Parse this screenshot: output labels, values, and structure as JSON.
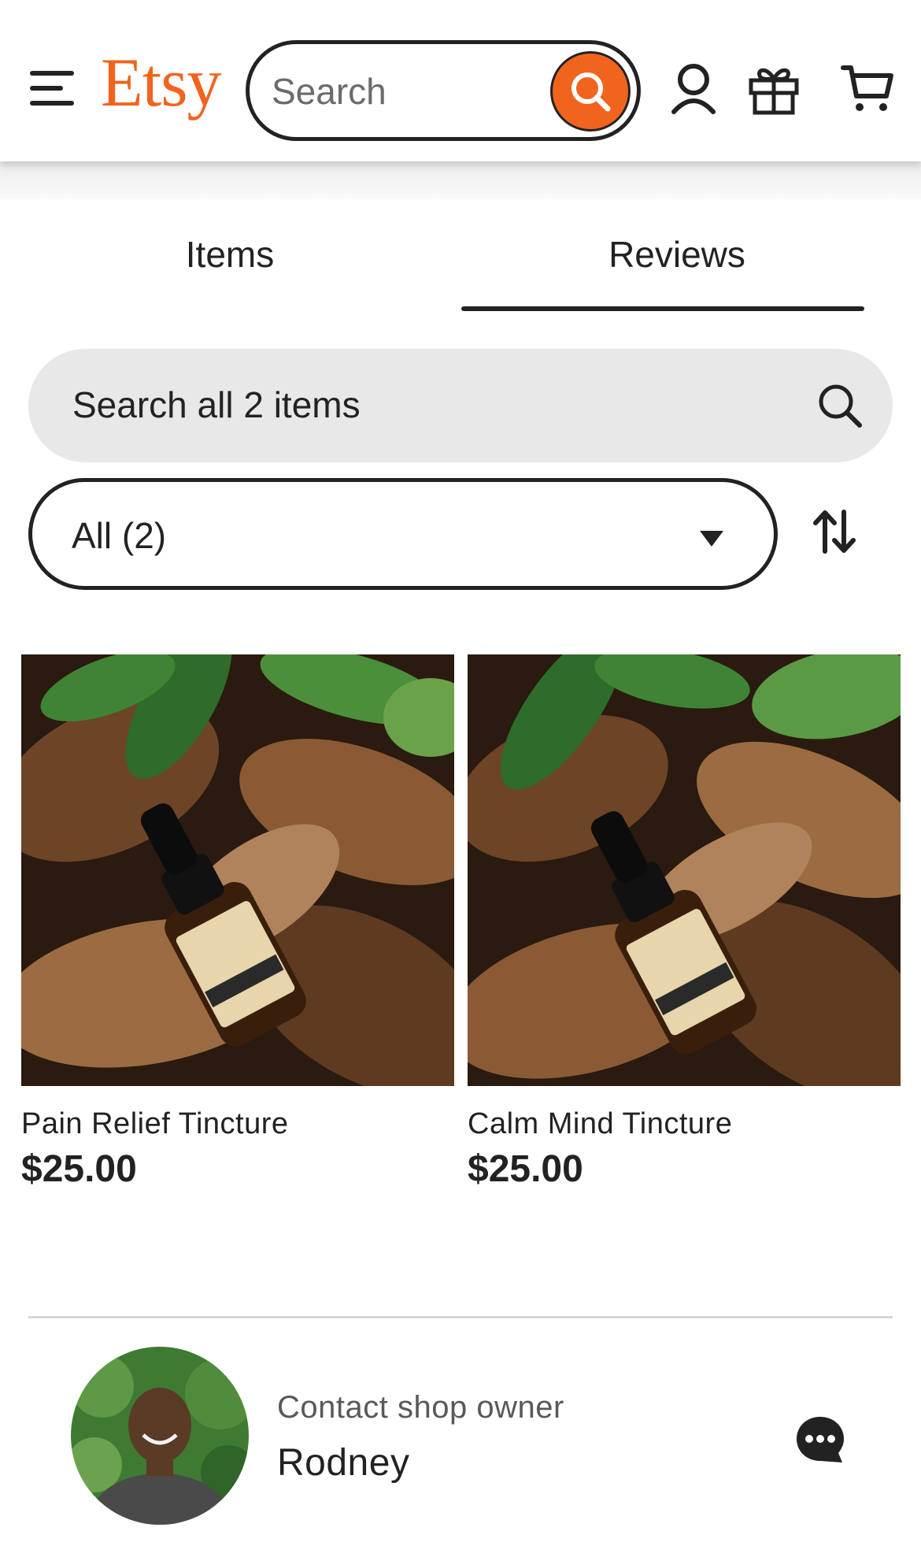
{
  "header": {
    "logo_text": "Etsy",
    "search_placeholder": "Search",
    "icons": [
      "menu-icon",
      "search-icon",
      "account-icon",
      "gift-icon",
      "cart-icon"
    ],
    "brand_color": "#f1641e"
  },
  "tabs": [
    {
      "label": "Items",
      "active": false
    },
    {
      "label": "Reviews",
      "active": true
    }
  ],
  "shop_search": {
    "placeholder": "Search all 2 items"
  },
  "filter": {
    "selected": "All (2)",
    "sort_icon": "sort-arrows-icon"
  },
  "listings": [
    {
      "title": "Pain Relief Tincture",
      "price": "$25.00",
      "image": "tincture-bottle-on-leaves-photo"
    },
    {
      "title": "Calm Mind Tincture",
      "price": "$25.00",
      "image": "tincture-bottle-on-leaves-photo"
    }
  ],
  "owner": {
    "label": "Contact shop owner",
    "name": "Rodney",
    "icon": "chat-icon"
  }
}
